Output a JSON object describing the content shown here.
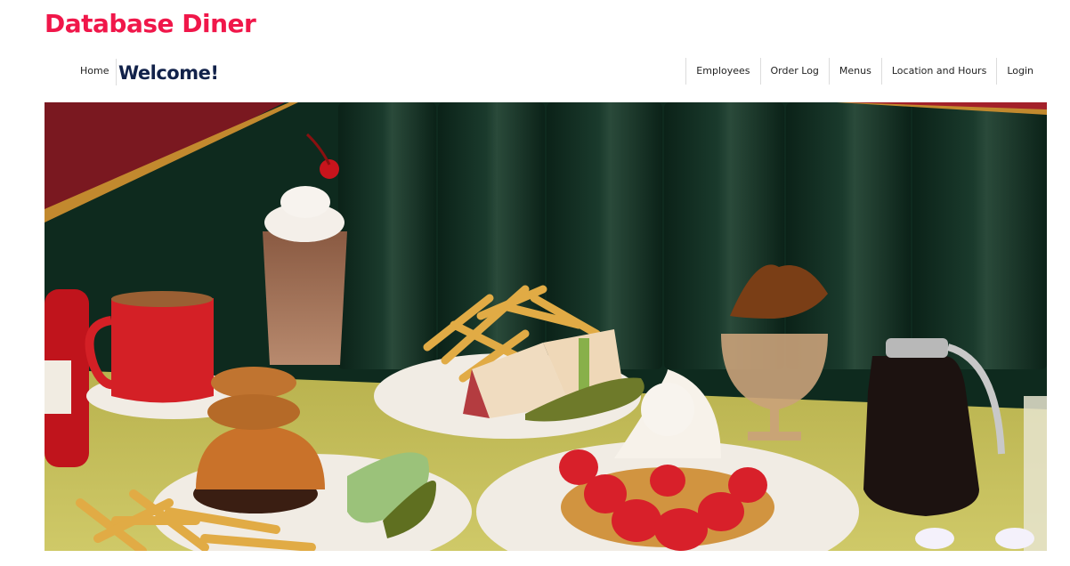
{
  "brand": {
    "title": "Database Diner"
  },
  "nav": {
    "home": "Home",
    "page_title": "Welcome!",
    "links": [
      "Employees",
      "Order Log",
      "Menus",
      "Location and Hours",
      "Login"
    ]
  },
  "colors": {
    "brand": "#f0174a",
    "heading": "#12224a",
    "booth": "#0f2a1f",
    "table": "#c9c55a"
  }
}
